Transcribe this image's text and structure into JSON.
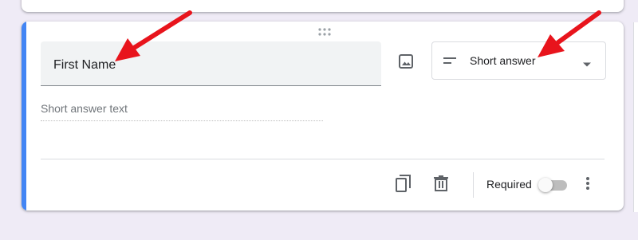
{
  "question": {
    "title_value": "First Name",
    "answer_placeholder": "Short answer text"
  },
  "type_select": {
    "selected_label": "Short answer",
    "icon": "short-text-icon"
  },
  "footer": {
    "required_label": "Required",
    "required_on": false
  },
  "icons": {
    "drag": "drag-handle-icon",
    "image": "image-icon",
    "duplicate": "duplicate-icon",
    "delete": "trash-icon",
    "more": "more-vertical-icon",
    "annotation": "red-arrow-icon"
  },
  "colors": {
    "accent": "#4285f4",
    "background": "#efebf6",
    "arrow": "#e8141c"
  }
}
